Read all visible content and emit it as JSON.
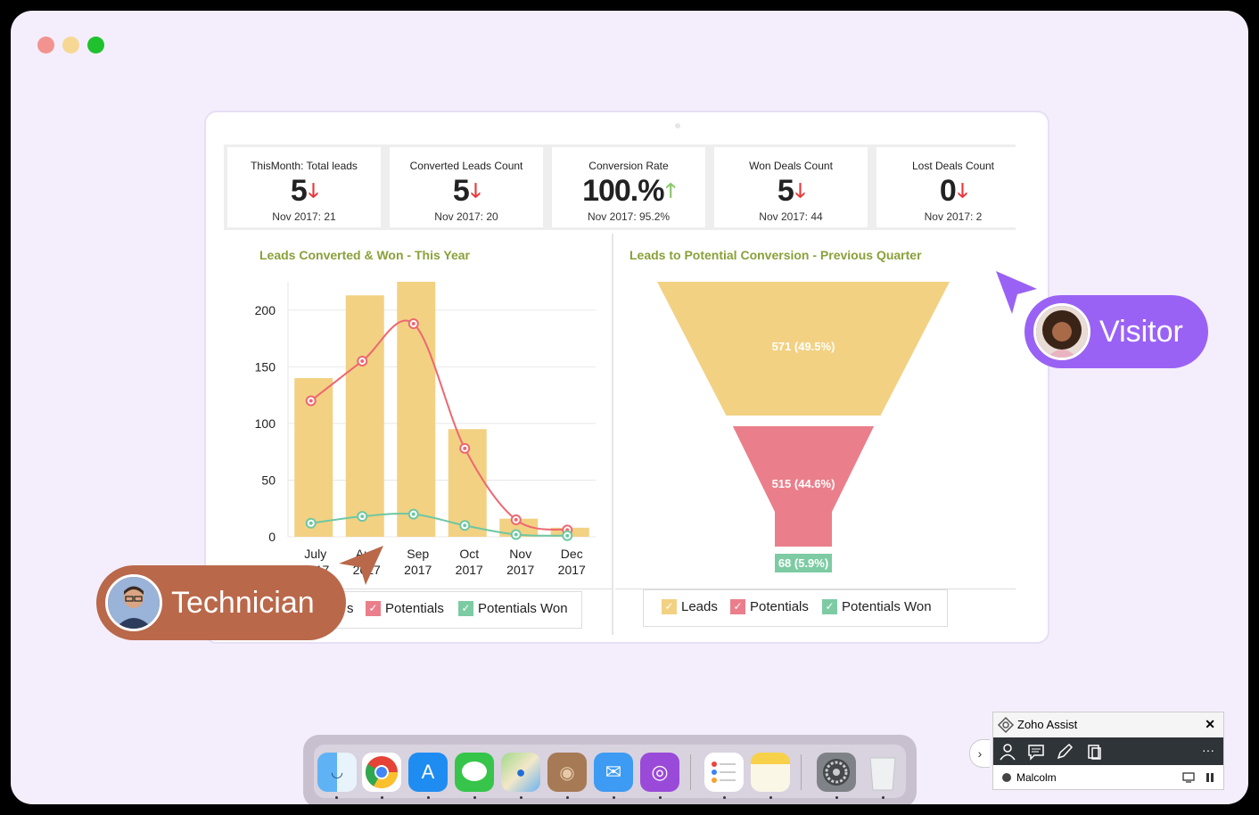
{
  "kpis": [
    {
      "title": "ThisMonth: Total leads",
      "value": "5",
      "trend": "down",
      "sub": "Nov 2017: 21"
    },
    {
      "title": "Converted Leads Count",
      "value": "5",
      "trend": "down",
      "sub": "Nov 2017: 20"
    },
    {
      "title": "Conversion Rate",
      "value": "100.%",
      "trend": "up",
      "sub": "Nov 2017: 95.2%"
    },
    {
      "title": "Won Deals Count",
      "value": "5",
      "trend": "down",
      "sub": "Nov 2017: 44"
    },
    {
      "title": "Lost Deals Count",
      "value": "0",
      "trend": "down",
      "sub": "Nov 2017: 2"
    }
  ],
  "colors": {
    "leads": "#f2d183",
    "potentials": "#ea7f8b",
    "potentials_won": "#7dcba3",
    "line_red": "#ee6770",
    "line_green": "#6fc7a2",
    "title_green": "#8aa03a"
  },
  "chart_data": [
    {
      "type": "bar",
      "title": "Leads Converted & Won - This Year",
      "categories": [
        [
          "July",
          "2017"
        ],
        [
          "Aug",
          "2017"
        ],
        [
          "Sep",
          "2017"
        ],
        [
          "Oct",
          "2017"
        ],
        [
          "Nov",
          "2017"
        ],
        [
          "Dec",
          "2017"
        ]
      ],
      "yticks": [
        0,
        50,
        100,
        150,
        200
      ],
      "ylim": [
        0,
        225
      ],
      "series": [
        {
          "name": "Leads",
          "kind": "bar",
          "values": [
            140,
            213,
            225,
            95,
            16,
            8
          ]
        },
        {
          "name": "Potentials",
          "kind": "line",
          "values": [
            120,
            155,
            188,
            78,
            15,
            6
          ]
        },
        {
          "name": "Potentials Won",
          "kind": "line",
          "values": [
            12,
            18,
            20,
            10,
            2,
            1
          ]
        }
      ],
      "legend": [
        "Leads",
        "Potentials",
        "Potentials Won"
      ],
      "legend_visible": [
        "s",
        "Potentials",
        "Potentials Won"
      ]
    },
    {
      "type": "funnel",
      "title": "Leads to Potential Conversion - Previous Quarter",
      "stages": [
        {
          "name": "Leads",
          "value": 571,
          "label": "571 (49.5%)"
        },
        {
          "name": "Potentials",
          "value": 515,
          "label": "515 (44.6%)"
        },
        {
          "name": "Potentials Won",
          "value": 68,
          "label": "68 (5.9%)"
        }
      ],
      "legend": [
        "Leads",
        "Potentials",
        "Potentials Won"
      ]
    }
  ],
  "badges": {
    "technician": "Technician",
    "visitor": "Visitor"
  },
  "zoho": {
    "title": "Zoho Assist",
    "user": "Malcolm",
    "close": "✕",
    "more": "···",
    "expand": "›"
  }
}
